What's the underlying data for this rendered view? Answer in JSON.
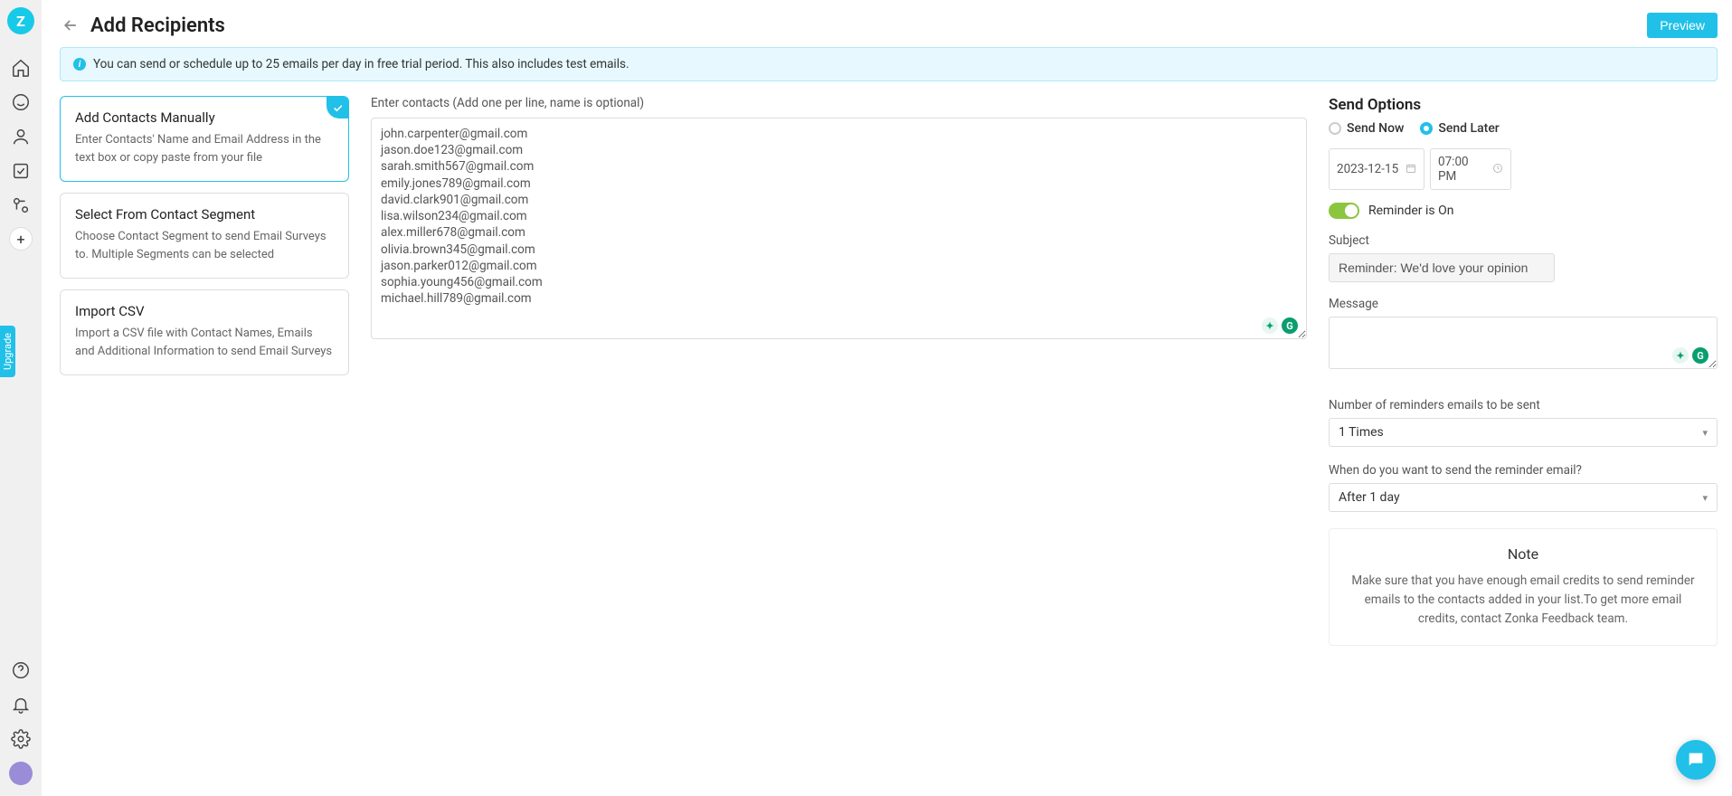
{
  "brand": {
    "logo_letter": "Z"
  },
  "upgrade_tab": "Upgrade",
  "header": {
    "title": "Add Recipients",
    "preview_button": "Preview"
  },
  "info_banner": "You can send or schedule up to 25 emails per day in free trial period. This also includes test emails.",
  "methods": [
    {
      "title": "Add Contacts Manually",
      "desc": "Enter Contacts' Name and Email Address in the text box or copy paste from your file",
      "active": true
    },
    {
      "title": "Select From Contact Segment",
      "desc": "Choose Contact Segment to send Email Surveys to. Multiple Segments can be selected",
      "active": false
    },
    {
      "title": "Import CSV",
      "desc": "Import a CSV file with Contact Names, Emails and Additional Information to send Email Surveys",
      "active": false
    }
  ],
  "contacts": {
    "label": "Enter contacts (Add one per line, name is optional)",
    "value": "john.carpenter@gmail.com\njason.doe123@gmail.com\nsarah.smith567@gmail.com\nemily.jones789@gmail.com\ndavid.clark901@gmail.com\nlisa.wilson234@gmail.com\nalex.miller678@gmail.com\nolivia.brown345@gmail.com\njason.parker012@gmail.com\nsophia.young456@gmail.com\nmichael.hill789@gmail.com"
  },
  "send_options": {
    "title": "Send Options",
    "send_now": "Send Now",
    "send_later": "Send Later",
    "selected": "later",
    "date": "2023-12-15",
    "time": "07:00 PM",
    "reminder_label": "Reminder is On",
    "subject_label": "Subject",
    "subject_value": "Reminder: We'd love your opinion",
    "message_label": "Message",
    "message_value": "",
    "reminders_count_label": "Number of reminders emails to be sent",
    "reminders_count_value": "1 Times",
    "reminder_when_label": "When do you want to send the reminder email?",
    "reminder_when_value": "After 1 day",
    "note_title": "Note",
    "note_body": "Make sure that you have enough email credits to send reminder emails to the contacts added in your list.To get more email credits, contact Zonka Feedback team."
  }
}
